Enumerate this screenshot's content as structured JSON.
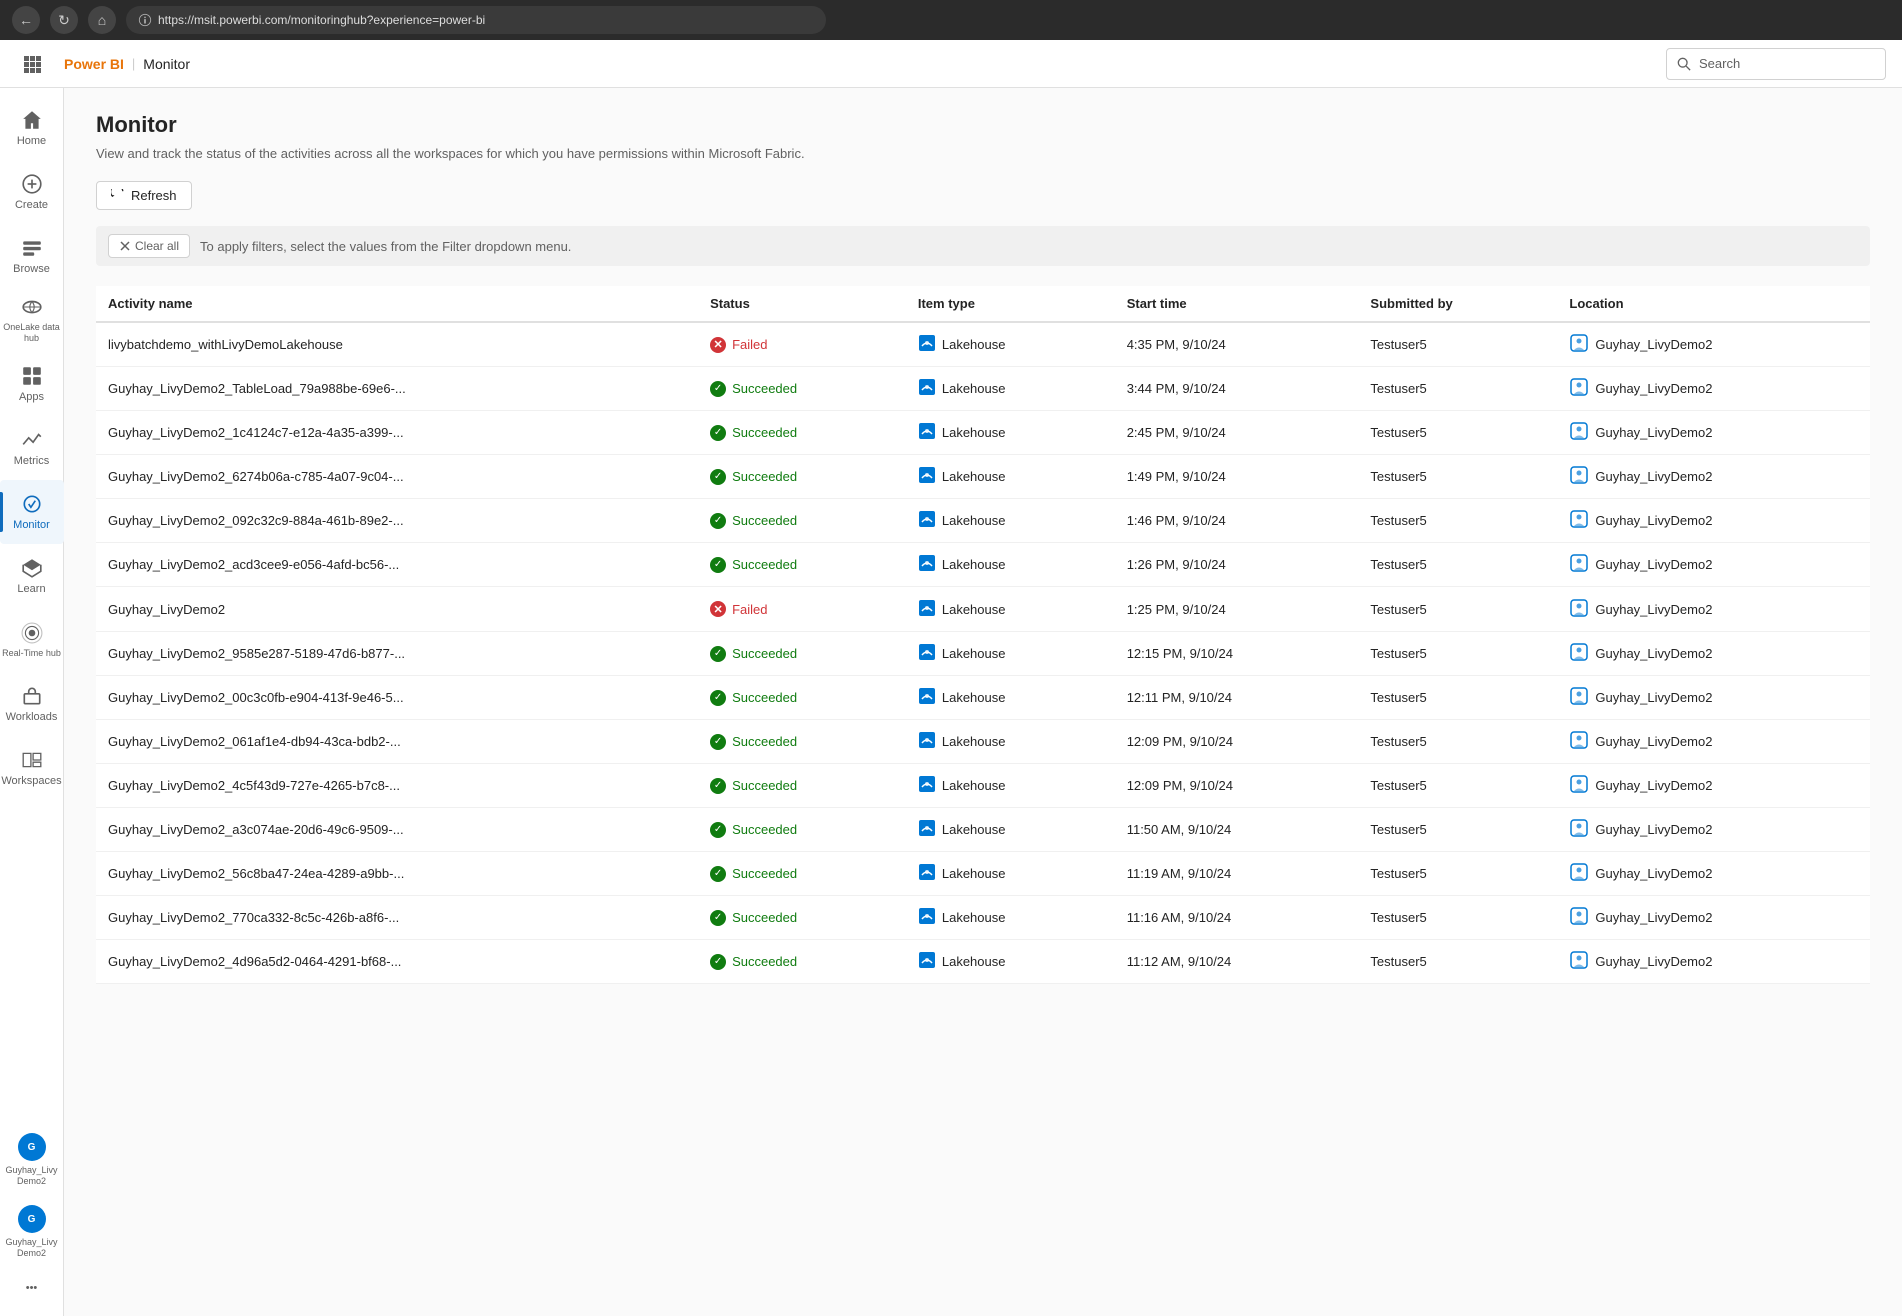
{
  "browser": {
    "url": "https://msit.powerbi.com/monitoringhub?experience=power-bi"
  },
  "topnav": {
    "brand": "Power BI",
    "separator": "|",
    "page": "Monitor",
    "search_placeholder": "Search"
  },
  "sidebar": {
    "items": [
      {
        "id": "home",
        "label": "Home",
        "active": false
      },
      {
        "id": "create",
        "label": "Create",
        "active": false
      },
      {
        "id": "browse",
        "label": "Browse",
        "active": false
      },
      {
        "id": "onelake",
        "label": "OneLake data hub",
        "active": false
      },
      {
        "id": "apps",
        "label": "Apps",
        "active": false
      },
      {
        "id": "metrics",
        "label": "Metrics",
        "active": false
      },
      {
        "id": "monitor",
        "label": "Monitor",
        "active": true
      },
      {
        "id": "learn",
        "label": "Learn",
        "active": false
      },
      {
        "id": "realtime",
        "label": "Real-Time hub",
        "active": false
      },
      {
        "id": "workloads",
        "label": "Workloads",
        "active": false
      },
      {
        "id": "workspaces",
        "label": "Workspaces",
        "active": false
      }
    ],
    "workspace_items": [
      {
        "id": "guyhay_livy1",
        "label": "Guyhay_Livy Demo2",
        "initials": "G"
      },
      {
        "id": "guyhay_livy2",
        "label": "Guyhay_Livy Demo2",
        "initials": "G"
      }
    ],
    "more_label": "..."
  },
  "page": {
    "title": "Monitor",
    "subtitle": "View and track the status of the activities across all the workspaces for which you have permissions within Microsoft Fabric.",
    "refresh_label": "Refresh",
    "clear_all_label": "Clear all",
    "filter_hint": "To apply filters, select the values from the Filter dropdown menu."
  },
  "table": {
    "columns": [
      "Activity name",
      "Status",
      "Item type",
      "Start time",
      "Submitted by",
      "Location"
    ],
    "rows": [
      {
        "activity_name": "livybatchdemo_withLivyDemoLakehouse",
        "status": "Failed",
        "status_type": "failed",
        "item_type": "Lakehouse",
        "start_time": "4:35 PM, 9/10/24",
        "submitted_by": "Testuser5",
        "location": "Guyhay_LivyDemo2"
      },
      {
        "activity_name": "Guyhay_LivyDemo2_TableLoad_79a988be-69e6-...",
        "status": "Succeeded",
        "status_type": "succeeded",
        "item_type": "Lakehouse",
        "start_time": "3:44 PM, 9/10/24",
        "submitted_by": "Testuser5",
        "location": "Guyhay_LivyDemo2"
      },
      {
        "activity_name": "Guyhay_LivyDemo2_1c4124c7-e12a-4a35-a399-...",
        "status": "Succeeded",
        "status_type": "succeeded",
        "item_type": "Lakehouse",
        "start_time": "2:45 PM, 9/10/24",
        "submitted_by": "Testuser5",
        "location": "Guyhay_LivyDemo2"
      },
      {
        "activity_name": "Guyhay_LivyDemo2_6274b06a-c785-4a07-9c04-...",
        "status": "Succeeded",
        "status_type": "succeeded",
        "item_type": "Lakehouse",
        "start_time": "1:49 PM, 9/10/24",
        "submitted_by": "Testuser5",
        "location": "Guyhay_LivyDemo2"
      },
      {
        "activity_name": "Guyhay_LivyDemo2_092c32c9-884a-461b-89e2-...",
        "status": "Succeeded",
        "status_type": "succeeded",
        "item_type": "Lakehouse",
        "start_time": "1:46 PM, 9/10/24",
        "submitted_by": "Testuser5",
        "location": "Guyhay_LivyDemo2"
      },
      {
        "activity_name": "Guyhay_LivyDemo2_acd3cee9-e056-4afd-bc56-...",
        "status": "Succeeded",
        "status_type": "succeeded",
        "item_type": "Lakehouse",
        "start_time": "1:26 PM, 9/10/24",
        "submitted_by": "Testuser5",
        "location": "Guyhay_LivyDemo2"
      },
      {
        "activity_name": "Guyhay_LivyDemo2",
        "status": "Failed",
        "status_type": "failed",
        "item_type": "Lakehouse",
        "start_time": "1:25 PM, 9/10/24",
        "submitted_by": "Testuser5",
        "location": "Guyhay_LivyDemo2",
        "has_actions": true
      },
      {
        "activity_name": "Guyhay_LivyDemo2_9585e287-5189-47d6-b877-...",
        "status": "Succeeded",
        "status_type": "succeeded",
        "item_type": "Lakehouse",
        "start_time": "12:15 PM, 9/10/24",
        "submitted_by": "Testuser5",
        "location": "Guyhay_LivyDemo2"
      },
      {
        "activity_name": "Guyhay_LivyDemo2_00c3c0fb-e904-413f-9e46-5...",
        "status": "Succeeded",
        "status_type": "succeeded",
        "item_type": "Lakehouse",
        "start_time": "12:11 PM, 9/10/24",
        "submitted_by": "Testuser5",
        "location": "Guyhay_LivyDemo2"
      },
      {
        "activity_name": "Guyhay_LivyDemo2_061af1e4-db94-43ca-bdb2-...",
        "status": "Succeeded",
        "status_type": "succeeded",
        "item_type": "Lakehouse",
        "start_time": "12:09 PM, 9/10/24",
        "submitted_by": "Testuser5",
        "location": "Guyhay_LivyDemo2"
      },
      {
        "activity_name": "Guyhay_LivyDemo2_4c5f43d9-727e-4265-b7c8-...",
        "status": "Succeeded",
        "status_type": "succeeded",
        "item_type": "Lakehouse",
        "start_time": "12:09 PM, 9/10/24",
        "submitted_by": "Testuser5",
        "location": "Guyhay_LivyDemo2"
      },
      {
        "activity_name": "Guyhay_LivyDemo2_a3c074ae-20d6-49c6-9509-...",
        "status": "Succeeded",
        "status_type": "succeeded",
        "item_type": "Lakehouse",
        "start_time": "11:50 AM, 9/10/24",
        "submitted_by": "Testuser5",
        "location": "Guyhay_LivyDemo2"
      },
      {
        "activity_name": "Guyhay_LivyDemo2_56c8ba47-24ea-4289-a9bb-...",
        "status": "Succeeded",
        "status_type": "succeeded",
        "item_type": "Lakehouse",
        "start_time": "11:19 AM, 9/10/24",
        "submitted_by": "Testuser5",
        "location": "Guyhay_LivyDemo2"
      },
      {
        "activity_name": "Guyhay_LivyDemo2_770ca332-8c5c-426b-a8f6-...",
        "status": "Succeeded",
        "status_type": "succeeded",
        "item_type": "Lakehouse",
        "start_time": "11:16 AM, 9/10/24",
        "submitted_by": "Testuser5",
        "location": "Guyhay_LivyDemo2"
      },
      {
        "activity_name": "Guyhay_LivyDemo2_4d96a5d2-0464-4291-bf68-...",
        "status": "Succeeded",
        "status_type": "succeeded",
        "item_type": "Lakehouse",
        "start_time": "11:12 AM, 9/10/24",
        "submitted_by": "Testuser5",
        "location": "Guyhay_LivyDemo2"
      }
    ]
  }
}
